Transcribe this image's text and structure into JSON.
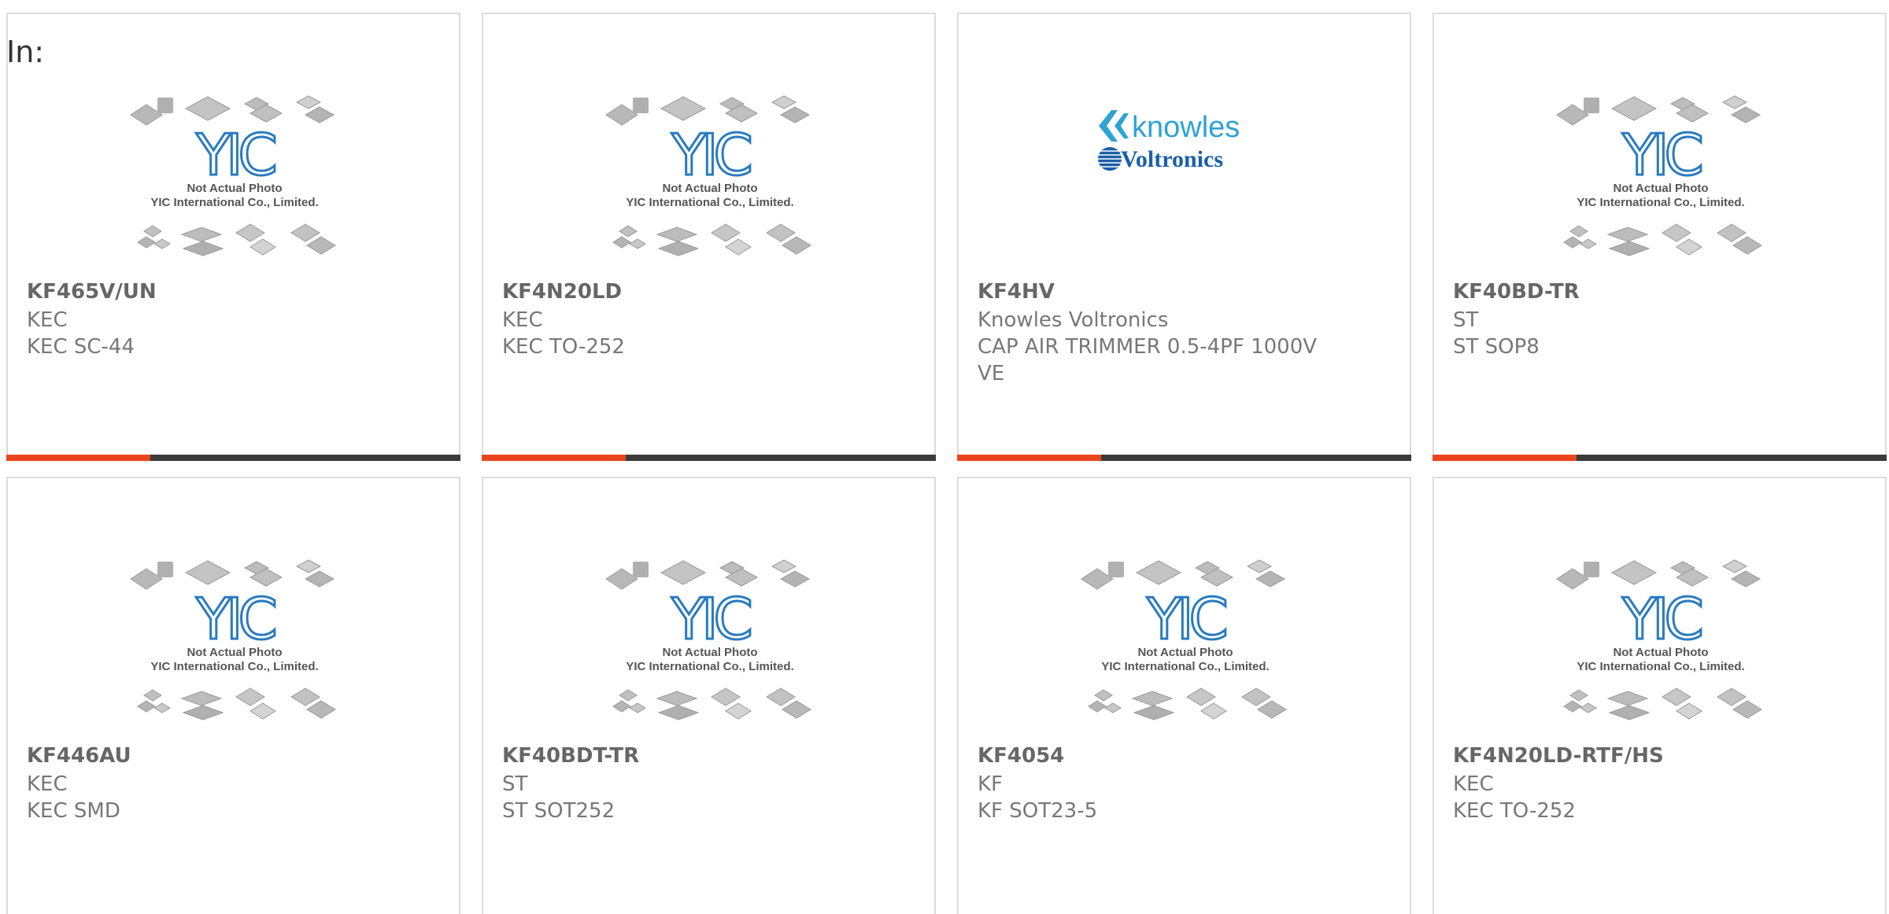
{
  "header": {
    "in_label": "In:"
  },
  "placeholder_image": {
    "caption_line1": "Not Actual Photo",
    "caption_line2": "YIC International Co., Limited.",
    "brand_color": "#2a7bbf"
  },
  "knowles_logo": {
    "line1": "knowles",
    "line2": "Voltronics",
    "color1": "#2ea3d5",
    "color2": "#1a5fa8"
  },
  "cards": [
    {
      "part": "KF465V/UN",
      "manufacturer": "KEC",
      "description": "KEC SC-44",
      "image": "yic-placeholder"
    },
    {
      "part": "KF4N20LD",
      "manufacturer": "KEC",
      "description": "KEC TO-252",
      "image": "yic-placeholder"
    },
    {
      "part": "KF4HV",
      "manufacturer": "Knowles Voltronics",
      "description": "CAP AIR TRIMMER 0.5-4PF 1000V VE",
      "image": "knowles-logo"
    },
    {
      "part": "KF40BD-TR",
      "manufacturer": "ST",
      "description": "ST SOP8",
      "image": "yic-placeholder"
    },
    {
      "part": "KF446AU",
      "manufacturer": "KEC",
      "description": "KEC SMD",
      "image": "yic-placeholder"
    },
    {
      "part": "KF40BDT-TR",
      "manufacturer": "ST",
      "description": "ST SOT252",
      "image": "yic-placeholder"
    },
    {
      "part": "KF4054",
      "manufacturer": "KF",
      "description": "KF SOT23-5",
      "image": "yic-placeholder"
    },
    {
      "part": "KF4N20LD-RTF/HS",
      "manufacturer": "KEC",
      "description": "KEC TO-252",
      "image": "yic-placeholder"
    }
  ],
  "colors": {
    "accent_bar": "#e8451d",
    "dark_bar": "#3b3b3b",
    "card_border": "#dcdcdc"
  }
}
